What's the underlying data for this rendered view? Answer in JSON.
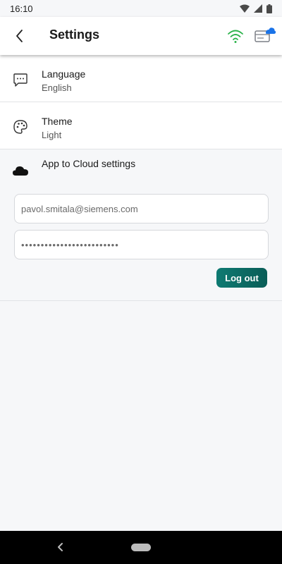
{
  "status_bar": {
    "time": "16:10"
  },
  "header": {
    "title": "Settings"
  },
  "settings": {
    "language": {
      "title": "Language",
      "value": "English"
    },
    "theme": {
      "title": "Theme",
      "value": "Light"
    }
  },
  "cloud": {
    "title": "App to Cloud settings",
    "email": "pavol.smitala@siemens.com",
    "password": "•••••••••••••••••••••••••",
    "logout_label": "Log out"
  },
  "colors": {
    "accent": "#0e7a72",
    "wifi": "#2bb34a",
    "cloud_badge": "#1a73e8"
  },
  "icons": {
    "back": "chevron-left-icon",
    "wifi": "wifi-icon",
    "cloud_status": "cloud-card-icon",
    "language": "chat-bubble-icon",
    "theme": "palette-icon",
    "cloud": "cloud-icon"
  }
}
